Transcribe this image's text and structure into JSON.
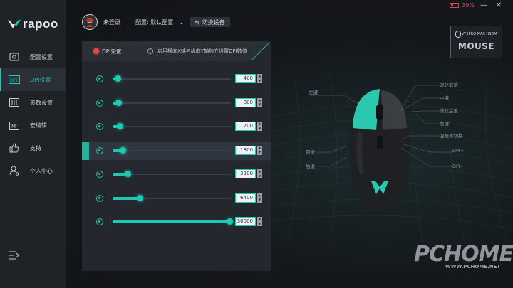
{
  "brand": {
    "logo_text": "rapoo",
    "accent": "#1ec8b2"
  },
  "window": {
    "battery": "39%",
    "minimize_label": "—",
    "close_label": "✕"
  },
  "sidebar": {
    "items": [
      {
        "label": "配置设置",
        "icon": "settings-panel-icon"
      },
      {
        "label": "DPI设置",
        "icon": "dpi-icon",
        "active": true
      },
      {
        "label": "参数设置",
        "icon": "sliders-icon"
      },
      {
        "label": "宏编辑",
        "icon": "macro-icon"
      },
      {
        "label": "支持",
        "icon": "thumbs-up-icon"
      },
      {
        "label": "个人中心",
        "icon": "user-gear-icon"
      }
    ]
  },
  "header": {
    "login": "未登录",
    "config": "配置: 默认配置",
    "switch_device": "切换设备"
  },
  "dpi_panel": {
    "tab_dpi": "DPI设置",
    "tab_xy": "启用横向X轴与纵向Y轴独立设置DPI数值",
    "max_dpi": 30000,
    "rows": [
      {
        "value": "400",
        "level": 400
      },
      {
        "value": "800",
        "level": 800
      },
      {
        "value": "1200",
        "level": 1200
      },
      {
        "value": "1800",
        "level": 1800,
        "active": true
      },
      {
        "value": "3200",
        "level": 3200
      },
      {
        "value": "6400",
        "level": 6400
      },
      {
        "value": "30000",
        "level": 30000
      }
    ]
  },
  "device": {
    "model": "VT1PRO MAX HSDM",
    "type": "MOUSE"
  },
  "mouse_labels": {
    "left": "左键",
    "scroll_forward": "滚轮前滚",
    "middle": "中键",
    "scroll_back": "滚轮后滚",
    "right": "右键",
    "polling": "回报率切换",
    "forward": "前进",
    "back": "后退",
    "dpi_plus": "DPI+",
    "dpi_minus": "DPI-"
  },
  "watermark": {
    "big": "PCHOME",
    "small": "WWW.PCHOME.NET"
  }
}
